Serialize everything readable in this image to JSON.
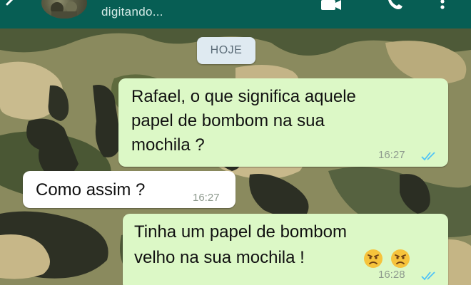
{
  "header": {
    "status": "digitando...",
    "icons": [
      "back-arrow-icon",
      "avatar",
      "video-call-icon",
      "phone-icon",
      "more-vert-icon"
    ],
    "bar_color": "#075e54"
  },
  "date_chip": "HOJE",
  "messages": [
    {
      "direction": "outgoing",
      "lines": [
        "Rafael, o que significa aquele",
        "papel de bombom na sua",
        "mochila ?"
      ],
      "time": "16:27",
      "read": true
    },
    {
      "direction": "incoming",
      "lines": [
        "Como assim ?"
      ],
      "time": "16:27"
    },
    {
      "direction": "outgoing",
      "lines": [
        "Tinha um papel de bombom",
        "velho na sua mochila !"
      ],
      "emojis": [
        "angry-face-emoji",
        "angry-face-emoji"
      ],
      "time": "16:28",
      "read": true
    }
  ],
  "colors": {
    "outgoing_bubble": "#dcf8c6",
    "incoming_bubble": "#ffffff",
    "read_ticks": "#4fc3f7",
    "timestamp": "#8e9a8e"
  }
}
